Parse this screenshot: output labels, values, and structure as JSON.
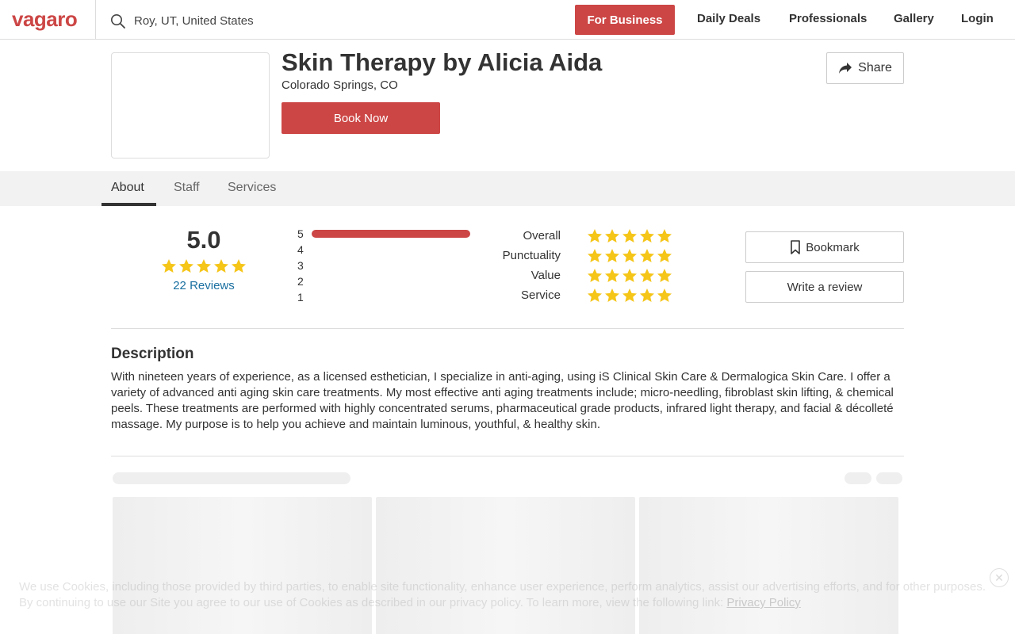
{
  "header": {
    "logo": "vagaro",
    "search_value": "Roy, UT, United States",
    "for_business_label": "For Business",
    "nav": [
      "Daily Deals",
      "Professionals",
      "Gallery",
      "Login"
    ],
    "accent_color": "#cc4645"
  },
  "business": {
    "name": "Skin Therapy by Alicia Aida",
    "location": "Colorado Springs, CO",
    "book_label": "Book Now",
    "share_label": "Share"
  },
  "tabs": [
    "About",
    "Staff",
    "Services"
  ],
  "tabs_active": "About",
  "ratings": {
    "score": "5.0",
    "score_stars": 5,
    "reviews_link": "22 Reviews",
    "histogram": [
      {
        "label": "5",
        "fraction": 1.0
      },
      {
        "label": "4",
        "fraction": 0
      },
      {
        "label": "3",
        "fraction": 0
      },
      {
        "label": "2",
        "fraction": 0
      },
      {
        "label": "1",
        "fraction": 0
      }
    ],
    "categories": [
      {
        "label": "Overall",
        "stars": 5
      },
      {
        "label": "Punctuality",
        "stars": 5
      },
      {
        "label": "Value",
        "stars": 5
      },
      {
        "label": "Service",
        "stars": 5
      }
    ],
    "star_color": "#f5c518",
    "bookmark_label": "Bookmark",
    "write_review_label": "Write a review"
  },
  "description": {
    "title": "Description",
    "body": "With nineteen years of experience, as a licensed esthetician, I specialize in anti-aging, using iS Clinical Skin Care & Dermalogica Skin Care. I offer a variety of advanced anti aging skin care treatments. My most effective anti aging treatments include; micro-needling, fibroblast skin lifting, & chemical peels. These treatments are performed with highly concentrated serums, pharmaceutical grade products, infrared light therapy, and facial & décolleté massage. My purpose is to help you achieve and maintain luminous, youthful, & healthy skin."
  },
  "cookie": {
    "text": "We use Cookies, including those provided by third parties, to enable site functionality, enhance user experience, perform analytics, assist our advertising efforts, and for other purposes. By continuing to use our Site you agree to our use of Cookies as described in our privacy policy. To learn more, view the following link:",
    "link": "Privacy Policy",
    "close": "✕"
  }
}
